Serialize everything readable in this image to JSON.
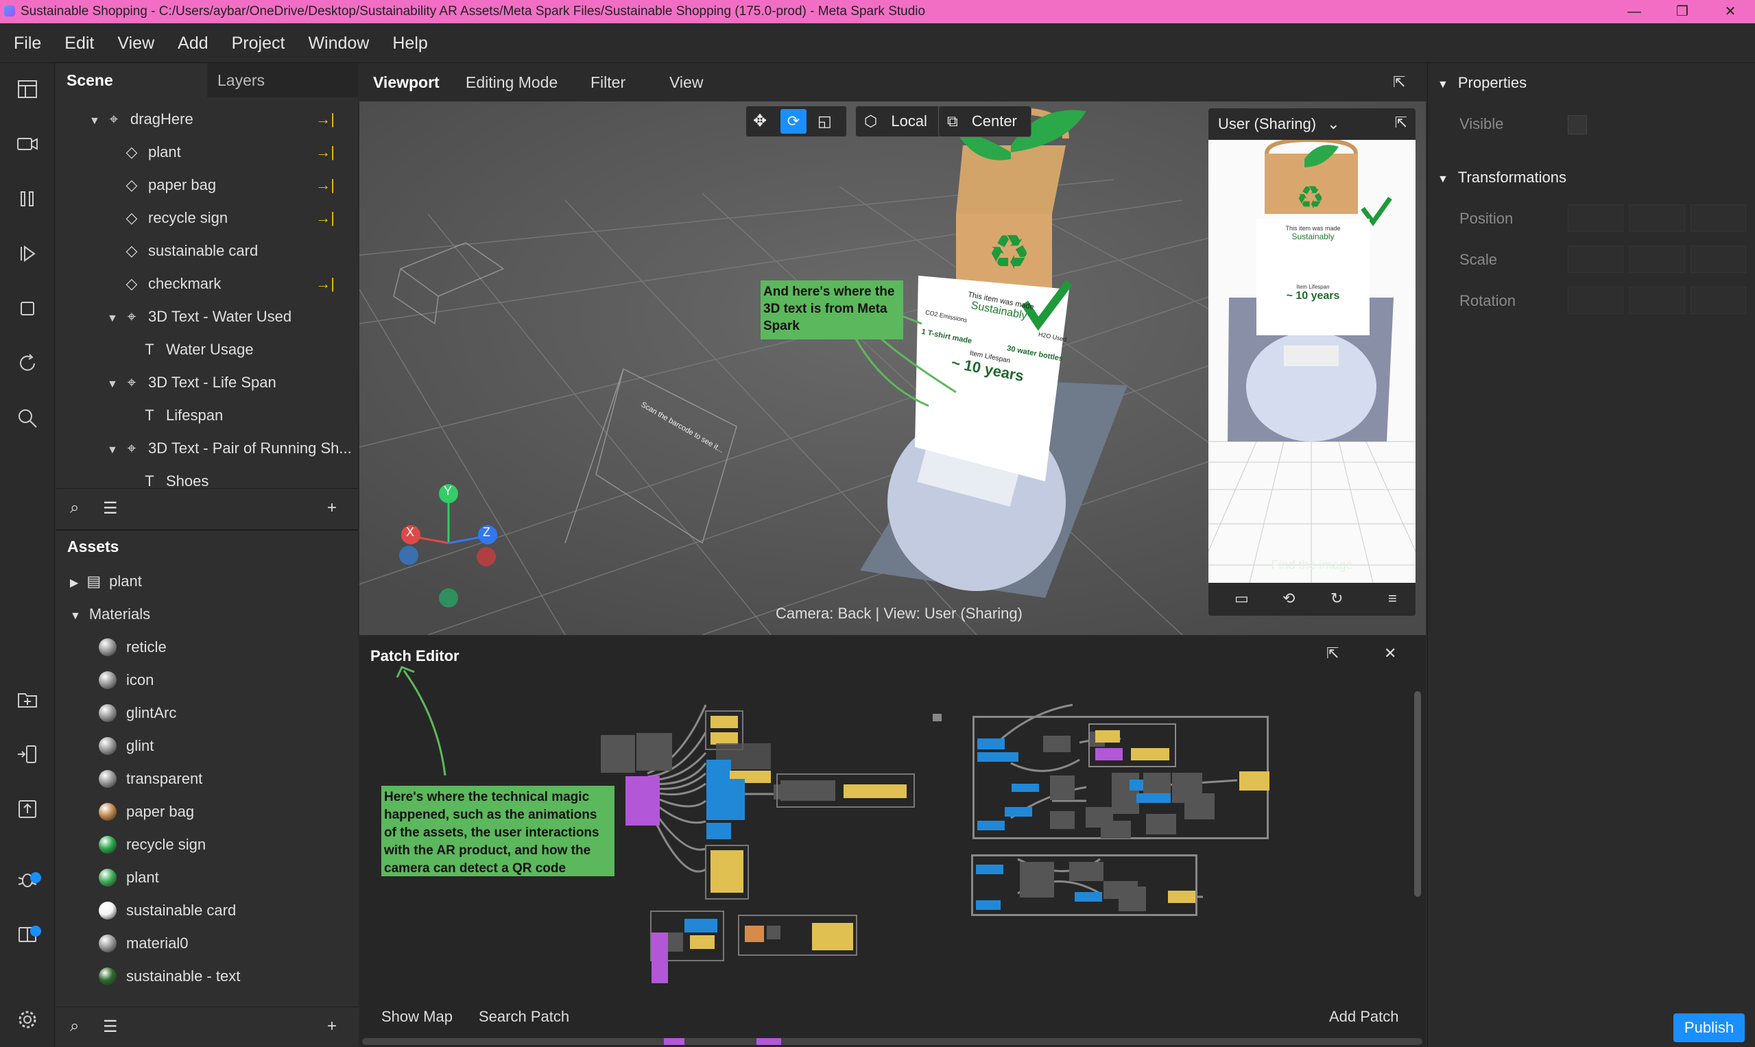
{
  "window": {
    "title": "Sustainable Shopping - C:/Users/aybar/OneDrive/Desktop/Sustainability AR Assets/Meta Spark Files/Sustainable Shopping (175.0-prod) - Meta Spark Studio",
    "minimize": "—",
    "maximize": "❐",
    "close": "✕"
  },
  "menu": [
    "File",
    "Edit",
    "View",
    "Add",
    "Project",
    "Window",
    "Help"
  ],
  "scene": {
    "tabs": [
      "Scene",
      "Layers"
    ],
    "tree": [
      {
        "label": "dragHere",
        "indent": 0,
        "expand": "▼",
        "icon": "null-object",
        "pin": true
      },
      {
        "label": "plant",
        "indent": 1,
        "expand": "",
        "icon": "plane",
        "pin": true
      },
      {
        "label": "paper bag",
        "indent": 1,
        "expand": "",
        "icon": "plane",
        "pin": true
      },
      {
        "label": "recycle sign",
        "indent": 1,
        "expand": "",
        "icon": "plane",
        "pin": true
      },
      {
        "label": "sustainable card",
        "indent": 1,
        "expand": "",
        "icon": "plane",
        "pin": false
      },
      {
        "label": "checkmark",
        "indent": 1,
        "expand": "",
        "icon": "plane",
        "pin": true
      },
      {
        "label": "3D Text - Water Used",
        "indent": 1,
        "expand": "▼",
        "icon": "null-object",
        "pin": false
      },
      {
        "label": "Water Usage",
        "indent": 2,
        "expand": "",
        "icon": "text",
        "pin": false
      },
      {
        "label": "3D Text - Life Span",
        "indent": 1,
        "expand": "▼",
        "icon": "null-object",
        "pin": false
      },
      {
        "label": "Lifespan",
        "indent": 2,
        "expand": "",
        "icon": "text",
        "pin": false
      },
      {
        "label": "3D Text - Pair of Running Sh...",
        "indent": 1,
        "expand": "▼",
        "icon": "null-object",
        "pin": false
      },
      {
        "label": "Shoes",
        "indent": 2,
        "expand": "",
        "icon": "text",
        "pin": false
      }
    ]
  },
  "assets": {
    "title": "Assets",
    "items": [
      {
        "label": "plant",
        "type": "file",
        "indent": 0,
        "expand": "▶"
      },
      {
        "label": "Materials",
        "type": "folder",
        "indent": 0,
        "expand": "▼"
      },
      {
        "label": "reticle",
        "type": "material",
        "color": "#9a9a9a"
      },
      {
        "label": "icon",
        "type": "material",
        "color": "#9a9a9a"
      },
      {
        "label": "glintArc",
        "type": "material",
        "color": "#9a9a9a"
      },
      {
        "label": "glint",
        "type": "material",
        "color": "#9a9a9a"
      },
      {
        "label": "transparent",
        "type": "material",
        "color": "#9a9a9a"
      },
      {
        "label": "paper bag",
        "type": "material",
        "color": "#c58a4e"
      },
      {
        "label": "recycle sign",
        "type": "material",
        "color": "#2aa84a"
      },
      {
        "label": "plant",
        "type": "material",
        "color": "#3fae5a"
      },
      {
        "label": "sustainable card",
        "type": "material",
        "color": "#f4f4f4"
      },
      {
        "label": "material0",
        "type": "material",
        "color": "#9a9a9a"
      },
      {
        "label": "sustainable - text",
        "type": "material",
        "color": "#2d6a2d"
      }
    ]
  },
  "viewport": {
    "tabs": [
      "Viewport",
      "Editing Mode",
      "Filter",
      "View"
    ],
    "toolbar": {
      "local": "Local",
      "center": "Center"
    },
    "camera_status": "Camera: Back | View: User (Sharing)",
    "note": "And here's where the 3D text is from Meta Spark",
    "preview": {
      "title": "User (Sharing)",
      "card_heading": "This item was made",
      "card_sub": "Sustainably",
      "lifespan_label": "Item Lifespan",
      "lifespan_value": "~ 10 years",
      "find_image": "Find the image"
    },
    "card": {
      "heading": "This item was made",
      "sub": "Sustainably",
      "co2": "CO2 Emissions",
      "h2o": "H2O Used",
      "shirt": "1 T-shirt made",
      "bottles": "30 water bottles",
      "lifespan_label": "Item Lifespan",
      "lifespan": "~ 10 years"
    },
    "gizmo": {
      "y": "Y",
      "x": "X",
      "z": "Z"
    }
  },
  "patch_editor": {
    "title": "Patch Editor",
    "note": "Here's where the technical magic happened, such as the animations of the assets, the user interactions with the AR product, and how the camera can detect a QR code",
    "show_map": "Show Map",
    "search_patch": "Search Patch",
    "add_patch": "Add Patch"
  },
  "properties": {
    "title": "Properties",
    "visible": "Visible",
    "transformations": "Transformations",
    "position": "Position",
    "scale": "Scale",
    "rotation": "Rotation"
  },
  "publish": "Publish",
  "colors": {
    "title_bar": "#f26ec4",
    "accent": "#1a8fff",
    "note_green": "#5cb85c",
    "pin_yellow": "#f2c400"
  }
}
